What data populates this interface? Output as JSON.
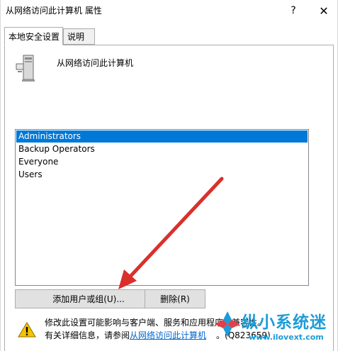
{
  "window": {
    "title": "从网络访问此计算机 属性",
    "help_label": "?",
    "close_label": "✕"
  },
  "tabs": [
    {
      "label": "本地安全设置",
      "active": true
    },
    {
      "label": "说明",
      "active": false
    }
  ],
  "policy": {
    "name": "从网络访问此计算机",
    "icon": "computer-tower-icon"
  },
  "user_list": {
    "items": [
      {
        "label": "Administrators",
        "selected": true
      },
      {
        "label": "Backup Operators",
        "selected": false
      },
      {
        "label": "Everyone",
        "selected": false
      },
      {
        "label": "Users",
        "selected": false
      }
    ]
  },
  "buttons": {
    "add_label": "添加用户或组(U)...",
    "delete_label": "删除(R)"
  },
  "notice": {
    "icon": "warning-icon",
    "line1": "修改此设置可能影响与客户端、服务和应用程序的兼容性。",
    "line2_prefix": "有关详细信息，请参阅",
    "link": "从网络访问此计算机",
    "line2_suffix": "。(Q823659)"
  },
  "watermark": {
    "text": "纵小系统迷",
    "url": "www.ilovext.com",
    "icon": "watermark-logo-icon"
  },
  "colors": {
    "selection": "#0078d7",
    "link": "#0066cc",
    "arrow": "#d9302c",
    "watermark": "#1b9cd8"
  }
}
